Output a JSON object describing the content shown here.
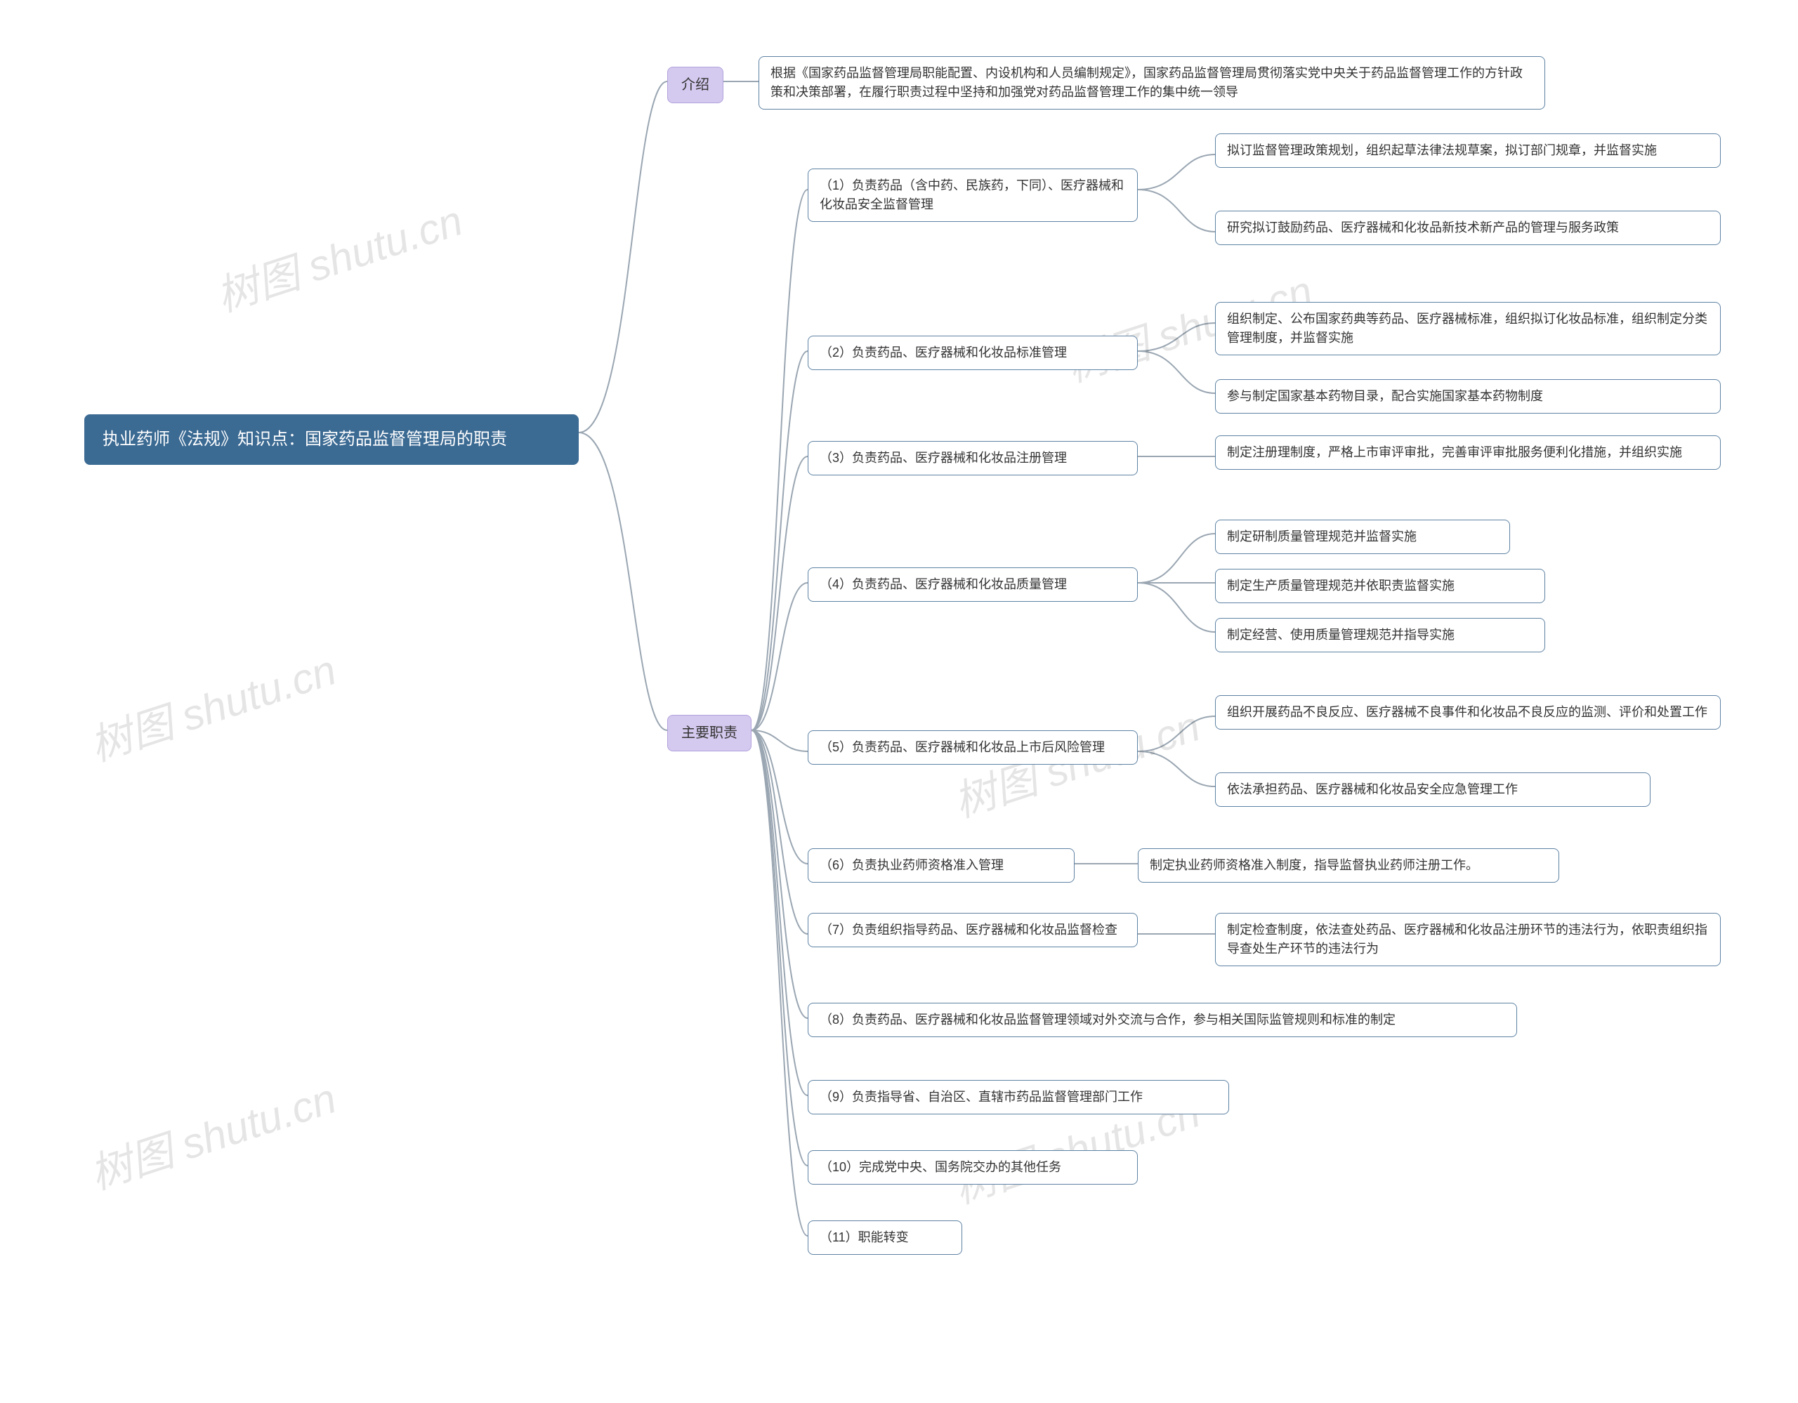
{
  "root": {
    "title": "执业药师《法规》知识点：国家药品监督管理局的职责"
  },
  "branch_intro": {
    "label": "介绍"
  },
  "branch_duties": {
    "label": "主要职责"
  },
  "intro_text": "根据《国家药品监督管理局职能配置、内设机构和人员编制规定》，国家药品监督管理局贯彻落实党中央关于药品监督管理工作的方针政策和决策部署，在履行职责过程中坚持和加强党对药品监督管理工作的集中统一领导",
  "d1": {
    "label": "（1）负责药品（含中药、民族药，下同）、医疗器械和化妆品安全监督管理",
    "c1": "拟订监督管理政策规划，组织起草法律法规草案，拟订部门规章，并监督实施",
    "c2": "研究拟订鼓励药品、医疗器械和化妆品新技术新产品的管理与服务政策"
  },
  "d2": {
    "label": "（2）负责药品、医疗器械和化妆品标准管理",
    "c1": "组织制定、公布国家药典等药品、医疗器械标准，组织拟订化妆品标准，组织制定分类管理制度，并监督实施",
    "c2": "参与制定国家基本药物目录，配合实施国家基本药物制度"
  },
  "d3": {
    "label": "（3）负责药品、医疗器械和化妆品注册管理",
    "c1": "制定注册理制度，严格上市审评审批，完善审评审批服务便利化措施，并组织实施"
  },
  "d4": {
    "label": "（4）负责药品、医疗器械和化妆品质量管理",
    "c1": "制定研制质量管理规范并监督实施",
    "c2": "制定生产质量管理规范并依职责监督实施",
    "c3": "制定经营、使用质量管理规范并指导实施"
  },
  "d5": {
    "label": "（5）负责药品、医疗器械和化妆品上市后风险管理",
    "c1": "组织开展药品不良反应、医疗器械不良事件和化妆品不良反应的监测、评价和处置工作",
    "c2": "依法承担药品、医疗器械和化妆品安全应急管理工作"
  },
  "d6": {
    "label": "（6）负责执业药师资格准入管理",
    "c1": "制定执业药师资格准入制度，指导监督执业药师注册工作。"
  },
  "d7": {
    "label": "（7）负责组织指导药品、医疗器械和化妆品监督检查",
    "c1": "制定检查制度，依法查处药品、医疗器械和化妆品注册环节的违法行为，依职责组织指导查处生产环节的违法行为"
  },
  "d8": {
    "label": "（8）负责药品、医疗器械和化妆品监督管理领域对外交流与合作，参与相关国际监管规则和标准的制定"
  },
  "d9": {
    "label": "（9）负责指导省、自治区、直辖市药品监督管理部门工作"
  },
  "d10": {
    "label": "（10）完成党中央、国务院交办的其他任务"
  },
  "d11": {
    "label": "（11）职能转变"
  },
  "watermark": "树图 shutu.cn"
}
